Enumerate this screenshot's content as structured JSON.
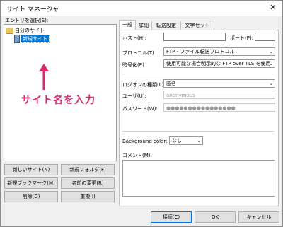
{
  "window": {
    "title": "サイト マネージャ",
    "close_glyph": "✕"
  },
  "tree": {
    "label": "エントリを選択(S):",
    "root": "自分のサイト",
    "child": "新規サイト"
  },
  "annotation": {
    "text": "サイト名を入力",
    "color": "#d52b6e"
  },
  "left_buttons": {
    "new_site": "新しいサイト(N)",
    "new_folder": "新規フォルダ(F)",
    "new_bookmark": "新規ブックマーク(M)",
    "rename": "名前の変更(R)",
    "delete": "削除(D)",
    "duplicate": "重複(I)"
  },
  "tabs": [
    "一般",
    "詳細",
    "転送設定",
    "文字セット"
  ],
  "general": {
    "host_label": "ホスト(H):",
    "host_value": "",
    "port_label": "ポート(P):",
    "port_value": "",
    "protocol_label": "プロトコル(T)",
    "protocol_value": "FTP - ファイル転送プロトコル",
    "encryption_label": "暗号化(E)",
    "encryption_value": "使用可能な場合明示的な FTP over TLS を使用",
    "logon_label": "ログオンの種類(L):",
    "logon_value": "匿名",
    "user_label": "ユーザ(U):",
    "user_value": "anonymous",
    "password_label": "パスワード(W):",
    "password_value": "●●●●●●●●●●●●●●●●",
    "bg_color_label": "Background color:",
    "bg_color_value": "なし",
    "comment_label": "コメント(M):",
    "comment_value": ""
  },
  "bottom_buttons": {
    "connect": "接続(C)",
    "ok": "OK",
    "cancel": "キャンセル"
  },
  "colors": {
    "selection": "#0078d7",
    "annotation": "#d52b6e"
  }
}
